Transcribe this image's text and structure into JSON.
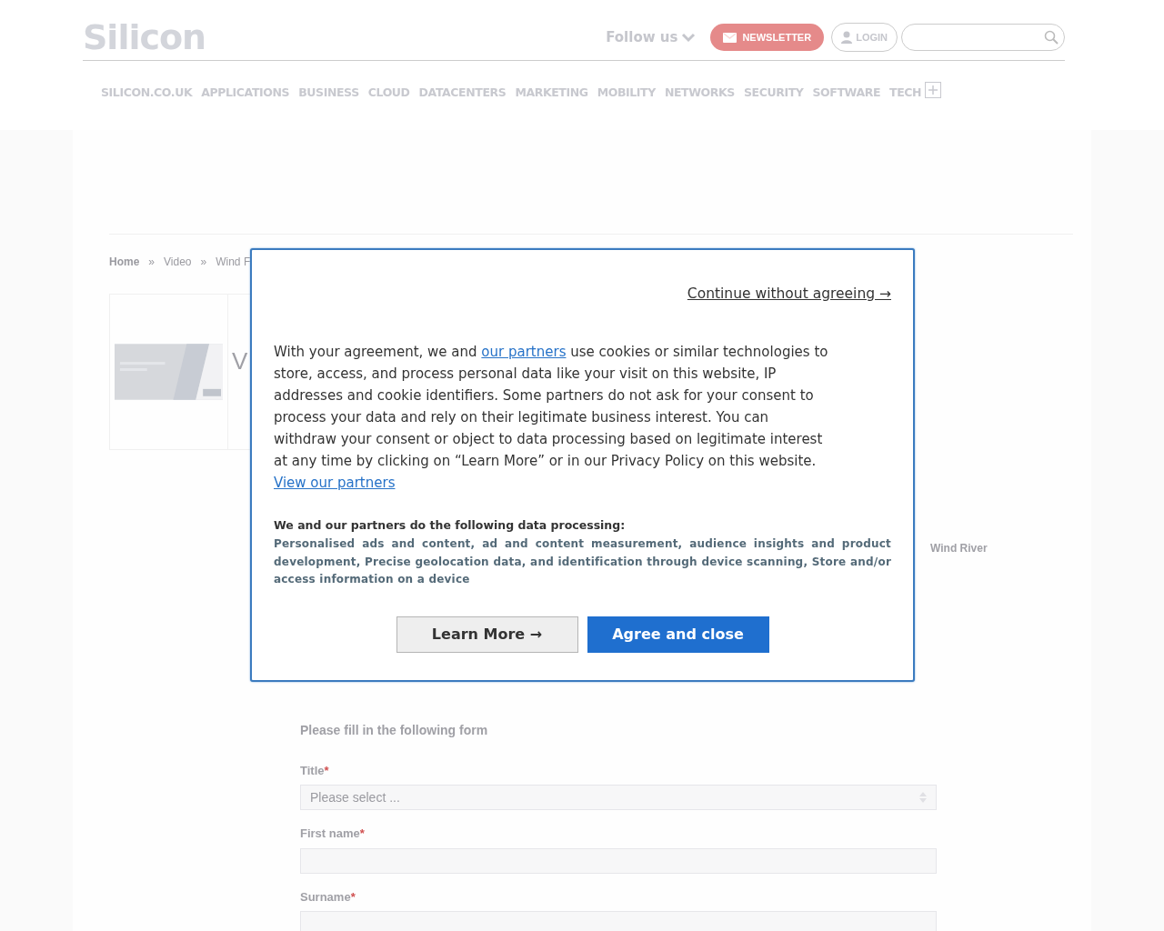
{
  "header": {
    "logo": "Silicon",
    "follow": "Follow us",
    "newsletter": "NEWSLETTER",
    "login": "LOGIN"
  },
  "nav": [
    "SILICON.CO.UK",
    "APPLICATIONS",
    "BUSINESS",
    "CLOUD",
    "DATACENTERS",
    "MARKETING",
    "MOBILITY",
    "NETWORKS",
    "SECURITY",
    "SOFTWARE",
    "TECH"
  ],
  "breadcrumb": [
    "Home",
    "»",
    "Video",
    "»",
    "Wind F"
  ],
  "article": {
    "title_fragment": "V",
    "sidebar_label": "Wind River"
  },
  "form": {
    "heading": "Please fill in the following form",
    "fields": [
      {
        "kind": "select",
        "label": "Title",
        "required": "*",
        "placeholder": "Please select ..."
      },
      {
        "kind": "text",
        "label": "First name",
        "required": "*"
      },
      {
        "kind": "text",
        "label": "Surname",
        "required": "*"
      }
    ]
  },
  "consent": {
    "skip_link": "Continue without agreeing →",
    "body": [
      {
        "kind": "text",
        "text": "With your agreement, we and "
      },
      {
        "kind": "link",
        "text": "our partners"
      },
      {
        "kind": "text",
        "text": " use cookies or similar technologies to store, access, and process personal data like your visit on this website, IP addresses and cookie identifiers. Some partners do not ask for your consent to process your data and rely on their legitimate business interest. You can withdraw your consent or object to data processing based on legitimate interest at any time by clicking on “Learn More” or in our Privacy Policy on this website. "
      },
      {
        "kind": "link",
        "text": "View our partners"
      }
    ],
    "processing_heading": "We and our partners do the following data processing:",
    "processing_list": "Personalised ads and content, ad and content measurement, audience insights and product development, Precise geolocation data, and identification through device scanning, Store and/or access information on a device",
    "buttons": [
      {
        "kind": "secondary",
        "label": "Learn More →"
      },
      {
        "kind": "primary",
        "label": "Agree and close"
      }
    ]
  }
}
